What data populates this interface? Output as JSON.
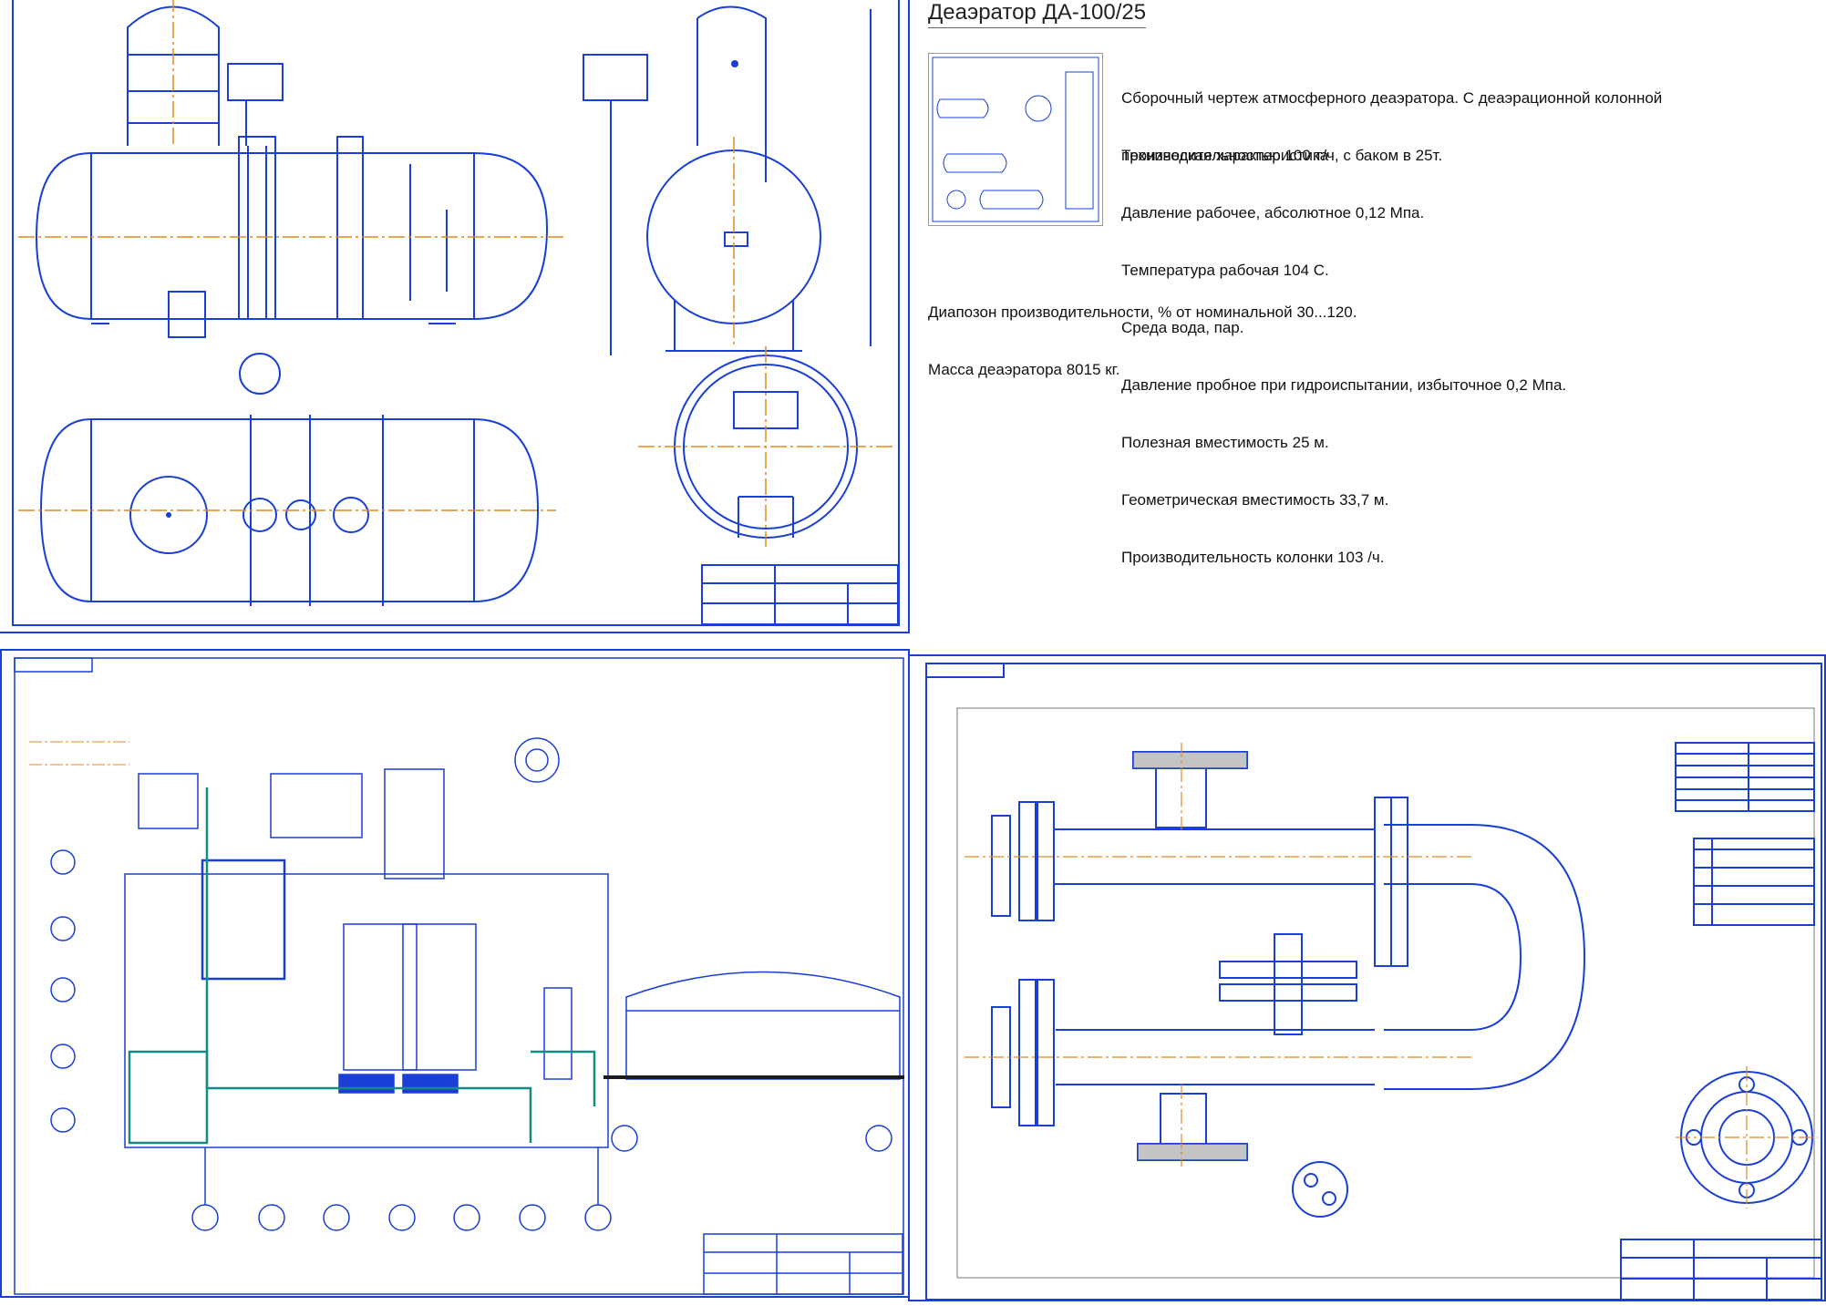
{
  "info": {
    "title": "Деаэратор ДА-100/25",
    "description": [
      "Сборочный чертеж атмосферного деаэратора. С деаэрационной колонной",
      "производительностью 100 т/ч, с баком в 25т."
    ],
    "specs": [
      "Техническая характеристика",
      "Давление рабочее, абсолютное 0,12 Мпа.",
      "Температура рабочая 104 С.",
      "Среда вода, пар.",
      "Давление пробное при гидроиспытании, избыточное 0,2 Мпа.",
      "Полезная вместимость 25 м.",
      "Геометрическая вместимость 33,7 м.",
      "Производительность колонки 103 /ч."
    ],
    "extra": [
      "Диапозон производительности, % от номинальной 30...120.",
      "Масса деаэратора 8015 кг."
    ]
  },
  "colors": {
    "line": "#1a3fd6",
    "axis": "#e08a1e",
    "teal": "#168a84",
    "dark": "#1a1a1a"
  }
}
